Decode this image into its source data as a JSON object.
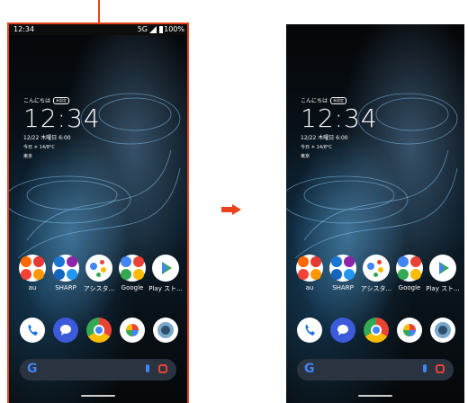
{
  "statusbar": {
    "time": "12:34",
    "network": "5G",
    "battery": "100%"
  },
  "clock": {
    "greeting": "こんにちは",
    "badge": "未設定",
    "time": "12:34",
    "date": "12/22 木曜日 6:00",
    "weather_line": "今日 ☀ 14/8°C",
    "location": "東京"
  },
  "apps": [
    {
      "label": "au"
    },
    {
      "label": "SHARP"
    },
    {
      "label": "アシスタ..."
    },
    {
      "label": "Google"
    },
    {
      "label": "Play スト..."
    }
  ],
  "dock": [
    "phone-icon",
    "messages-icon",
    "chrome-icon",
    "photos-icon",
    "camera-icon"
  ],
  "search": {
    "logo": "G"
  },
  "colors": {
    "accent": "#e8411c"
  }
}
